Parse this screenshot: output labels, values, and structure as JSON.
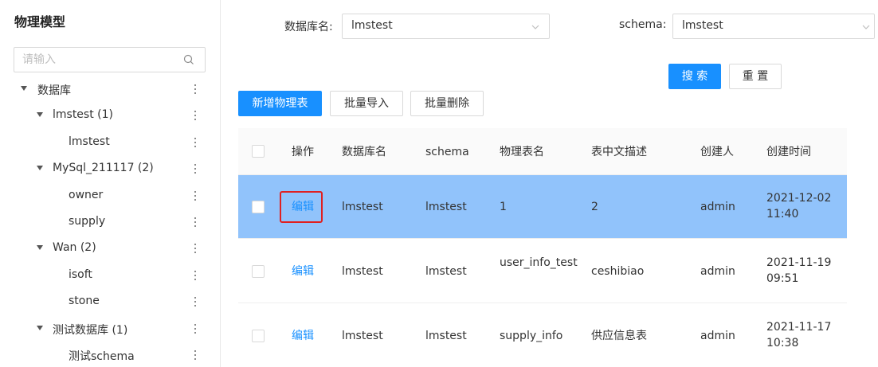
{
  "sidebar": {
    "title": "物理模型",
    "search_placeholder": "请输入",
    "tree": [
      {
        "label": "数据库"
      },
      {
        "label": "lmstest (1)"
      },
      {
        "label": "lmstest"
      },
      {
        "label": "MySql_211117 (2)"
      },
      {
        "label": "owner"
      },
      {
        "label": "supply"
      },
      {
        "label": "Wan (2)"
      },
      {
        "label": "isoft"
      },
      {
        "label": "stone"
      },
      {
        "label": "测试数据库 (1)"
      },
      {
        "label": "测试schema"
      }
    ]
  },
  "filters": {
    "db_label": "数据库名:",
    "db_value": "lmstest",
    "schema_label": "schema:",
    "schema_value": "lmstest"
  },
  "actions": {
    "search": "搜 索",
    "reset": "重 置",
    "add": "新增物理表",
    "import": "批量导入",
    "delete": "批量删除"
  },
  "table": {
    "headers": [
      "操作",
      "数据库名",
      "schema",
      "物理表名",
      "表中文描述",
      "创建人",
      "创建时间"
    ],
    "rows": [
      {
        "action": "编辑",
        "db": "lmstest",
        "schema": "lmstest",
        "table_name": "1",
        "desc": "2",
        "creator": "admin",
        "created": "2021-12-02 11:40",
        "selected": true
      },
      {
        "action": "编辑",
        "db": "lmstest",
        "schema": "lmstest",
        "table_name": "user_info_test",
        "desc": "ceshibiao",
        "creator": "admin",
        "created": "2021-11-19 09:51"
      },
      {
        "action": "编辑",
        "db": "lmstest",
        "schema": "lmstest",
        "table_name": "supply_info",
        "desc": "供应信息表",
        "creator": "admin",
        "created": "2021-11-17 10:38"
      }
    ]
  },
  "colors": {
    "primary": "#1890ff",
    "selected_row": "#91c3fb",
    "highlight": "#e02020"
  }
}
